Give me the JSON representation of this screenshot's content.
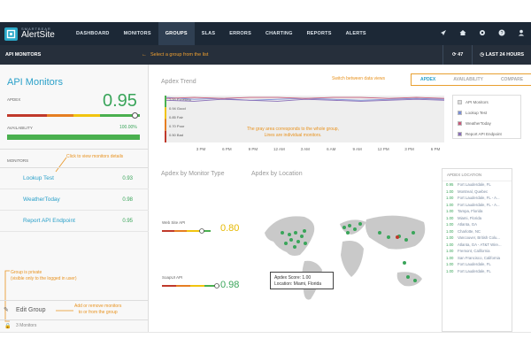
{
  "brand": {
    "small": "SMARTBEAR",
    "name": "AlertSite"
  },
  "nav": {
    "items": [
      "DASHBOARD",
      "MONITORS",
      "GROUPS",
      "SLAS",
      "ERRORS",
      "CHARTING",
      "REPORTS",
      "ALERTS"
    ],
    "active": "GROUPS"
  },
  "top": {
    "alerts_count": "47",
    "time_range": "LAST 24 HOURS"
  },
  "subbar": {
    "title": "API MONITORS",
    "hint": "Select a group from the list"
  },
  "sidebar": {
    "title": "API Monitors",
    "apdex_label": "APDEX",
    "apdex_value": "0.95",
    "availability_label": "AVAILABILITY",
    "availability_value": "100.00%",
    "availability_fraction": 1.0,
    "monitors_label": "MONITORS",
    "monitors_hint": "Click to view monitors details",
    "monitors": [
      {
        "name": "Lookup Test",
        "value": "0.93"
      },
      {
        "name": "WeatherToday",
        "value": "0.98"
      },
      {
        "name": "Report API Endpoint",
        "value": "0.95"
      }
    ],
    "private_hint": [
      "Group is private",
      "(visible only to the logged in user)"
    ],
    "edit_label": "Edit Group",
    "edit_hint": [
      "Add or remove monitors",
      "to or from the group"
    ],
    "count_label": "3 Monitors"
  },
  "main": {
    "trend_title": "Apdex Trend",
    "views_hint": "Switch between data views",
    "tabs": [
      "APDEX",
      "AVAILABILITY",
      "COMPARE"
    ],
    "active_tab": "APDEX",
    "trend_hint": [
      "The gray area corresponds to the whole group,",
      "Lines are individual monitors."
    ],
    "legend": [
      "API Monitors",
      "Lookup Test",
      "WeatherToday",
      "Report API Endpoint"
    ],
    "by_type_title": "Apdex by Monitor Type",
    "by_location_title": "Apdex by Location",
    "gauges": [
      {
        "label": "Web Site API",
        "value": "0.80",
        "color": "#e6b800"
      },
      {
        "label": "SoapUI API",
        "value": "0.98",
        "color": "#3aa55a"
      }
    ],
    "tooltip": {
      "score": "Apdex Score: 1.00",
      "location": "Location: Miami, Florida"
    },
    "locations_title": "APDEX LOCATION",
    "locations": [
      {
        "score": "0.95",
        "name": "Fort Lauderdale, FL"
      },
      {
        "score": "1.00",
        "name": "Montreal, Quebec"
      },
      {
        "score": "1.00",
        "name": "Fort Lauderdale, FL - A..."
      },
      {
        "score": "1.00",
        "name": "Fort Lauderdale, FL - A..."
      },
      {
        "score": "1.00",
        "name": "Tampa, Florida"
      },
      {
        "score": "1.00",
        "name": "Miami, Florida"
      },
      {
        "score": "1.00",
        "name": "Atlanta, GA"
      },
      {
        "score": "1.00",
        "name": "Charlotte, NC"
      },
      {
        "score": "1.00",
        "name": "Vancouver, British Colu..."
      },
      {
        "score": "1.00",
        "name": "Atlanta, GA - AT&T Wire..."
      },
      {
        "score": "1.00",
        "name": "Fremont, California"
      },
      {
        "score": "1.00",
        "name": "San Francisco, California"
      },
      {
        "score": "1.00",
        "name": "Fort Lauderdale, FL"
      },
      {
        "score": "1.00",
        "name": "Fort Lauderdale, FL"
      }
    ]
  },
  "chart_data": {
    "type": "line",
    "title": "Apdex Trend",
    "x_ticks": [
      "3 PM",
      "6 PM",
      "9 PM",
      "12 AM",
      "3 AM",
      "6 AM",
      "9 AM",
      "12 PM",
      "3 PM",
      "6 PM"
    ],
    "y_ticks": [
      "1.00 Excellent",
      "0.94 Good",
      "0.85 Fair",
      "0.70 Poor",
      "0.50 Bad"
    ],
    "ylim": [
      0.5,
      1.0
    ],
    "series": [
      {
        "name": "Lookup Test",
        "color": "#7a8fd6",
        "values": [
          0.98,
          0.96,
          0.97,
          0.95,
          0.96,
          0.97,
          0.96,
          0.95,
          0.96,
          0.97,
          0.96
        ]
      },
      {
        "name": "WeatherToday",
        "color": "#c85a7a",
        "values": [
          0.97,
          0.98,
          0.97,
          0.98,
          0.98,
          0.97,
          0.98,
          0.98,
          0.97,
          0.98,
          0.97
        ]
      },
      {
        "name": "Report API Endpoint",
        "color": "#8a6fb8",
        "values": [
          0.95,
          0.94,
          0.96,
          0.95,
          0.94,
          0.96,
          0.95,
          0.94,
          0.95,
          0.96,
          0.95
        ]
      }
    ]
  }
}
